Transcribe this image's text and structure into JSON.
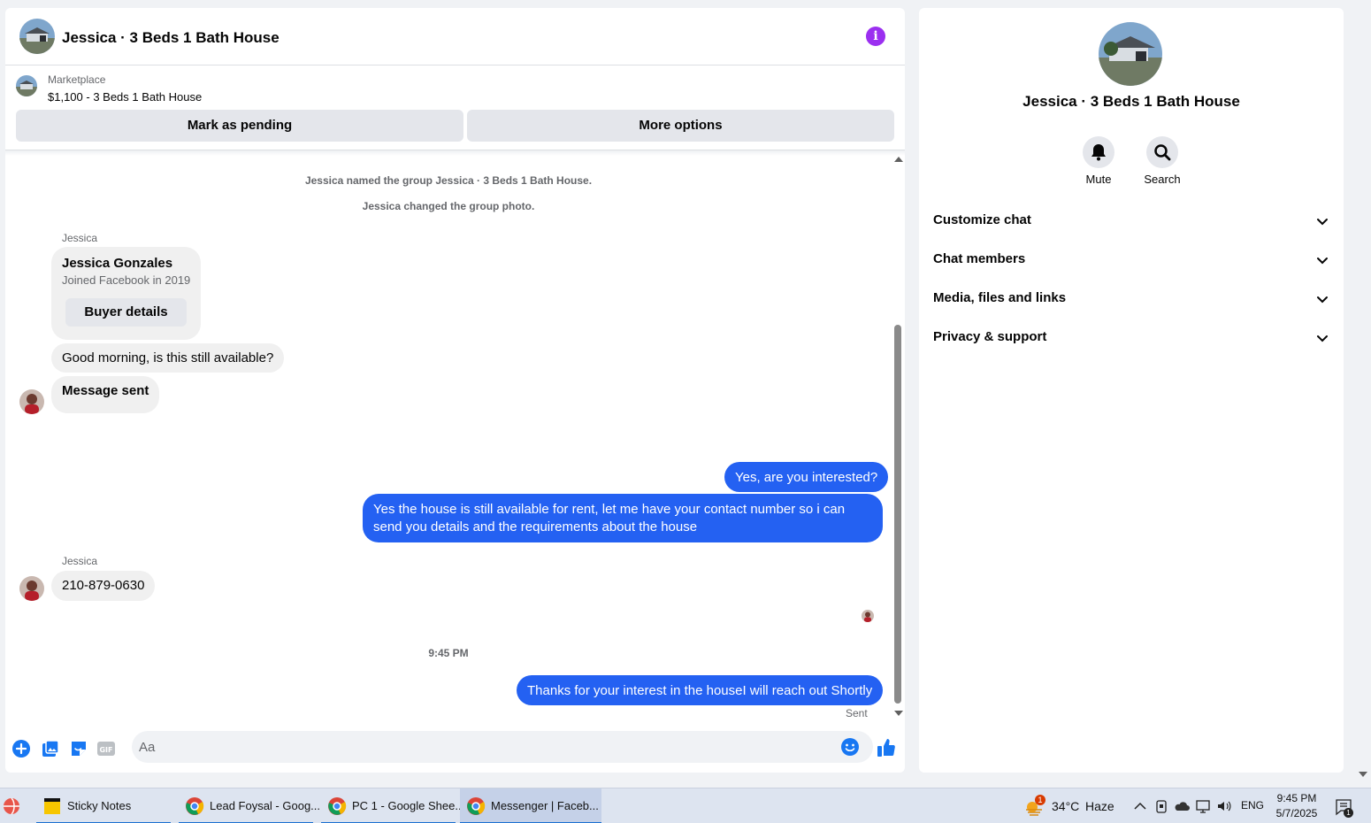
{
  "colors": {
    "messenger_blue": "#2461f2",
    "info_purple": "#9b2ff0",
    "bubble_gray": "#f0f0f0"
  },
  "chat": {
    "title": "Jessica · 3 Beds 1 Bath House",
    "marketplace_label": "Marketplace",
    "listing": "$1,100 - 3 Beds 1 Bath House",
    "mark_pending": "Mark as pending",
    "more_options": "More options",
    "system_messages": [
      "Jessica named the group Jessica · 3 Beds 1 Bath House.",
      "Jessica changed the group photo."
    ],
    "sender_name": "Jessica",
    "buyer_card": {
      "name": "Jessica Gonzales",
      "joined": "Joined Facebook in 2019",
      "button": "Buyer details"
    },
    "messages": [
      {
        "from": "Jessica",
        "text": "Good morning, is this still available?"
      },
      {
        "from": "Jessica",
        "text": "Message sent"
      },
      {
        "from": "me",
        "text": "Yes, are you interested?"
      },
      {
        "from": "me",
        "text": "Yes the house is still available for rent, let me have your contact number so i can send you details and the requirements about the house"
      },
      {
        "from": "Jessica",
        "text": "210-879-0630"
      },
      {
        "from": "me",
        "text": "Thanks for your interest in the houseI will reach out Shortly"
      }
    ],
    "timestamp": "9:45 PM",
    "sent_status": "Sent",
    "composer_placeholder": "Aa"
  },
  "details": {
    "title": "Jessica · 3 Beds 1 Bath House",
    "mute_label": "Mute",
    "search_label": "Search",
    "sections": [
      "Customize chat",
      "Chat members",
      "Media, files and links",
      "Privacy & support"
    ]
  },
  "taskbar": {
    "apps": [
      "Sticky Notes",
      "Lead Foysal - Goog...",
      "PC 1 - Google Shee...",
      "Messenger | Faceb..."
    ],
    "weather_badge": "1",
    "weather": "34°C",
    "weather_desc": "Haze",
    "language": "ENG",
    "time": "9:45 PM",
    "date": "5/7/2025",
    "notification_count": "1"
  }
}
